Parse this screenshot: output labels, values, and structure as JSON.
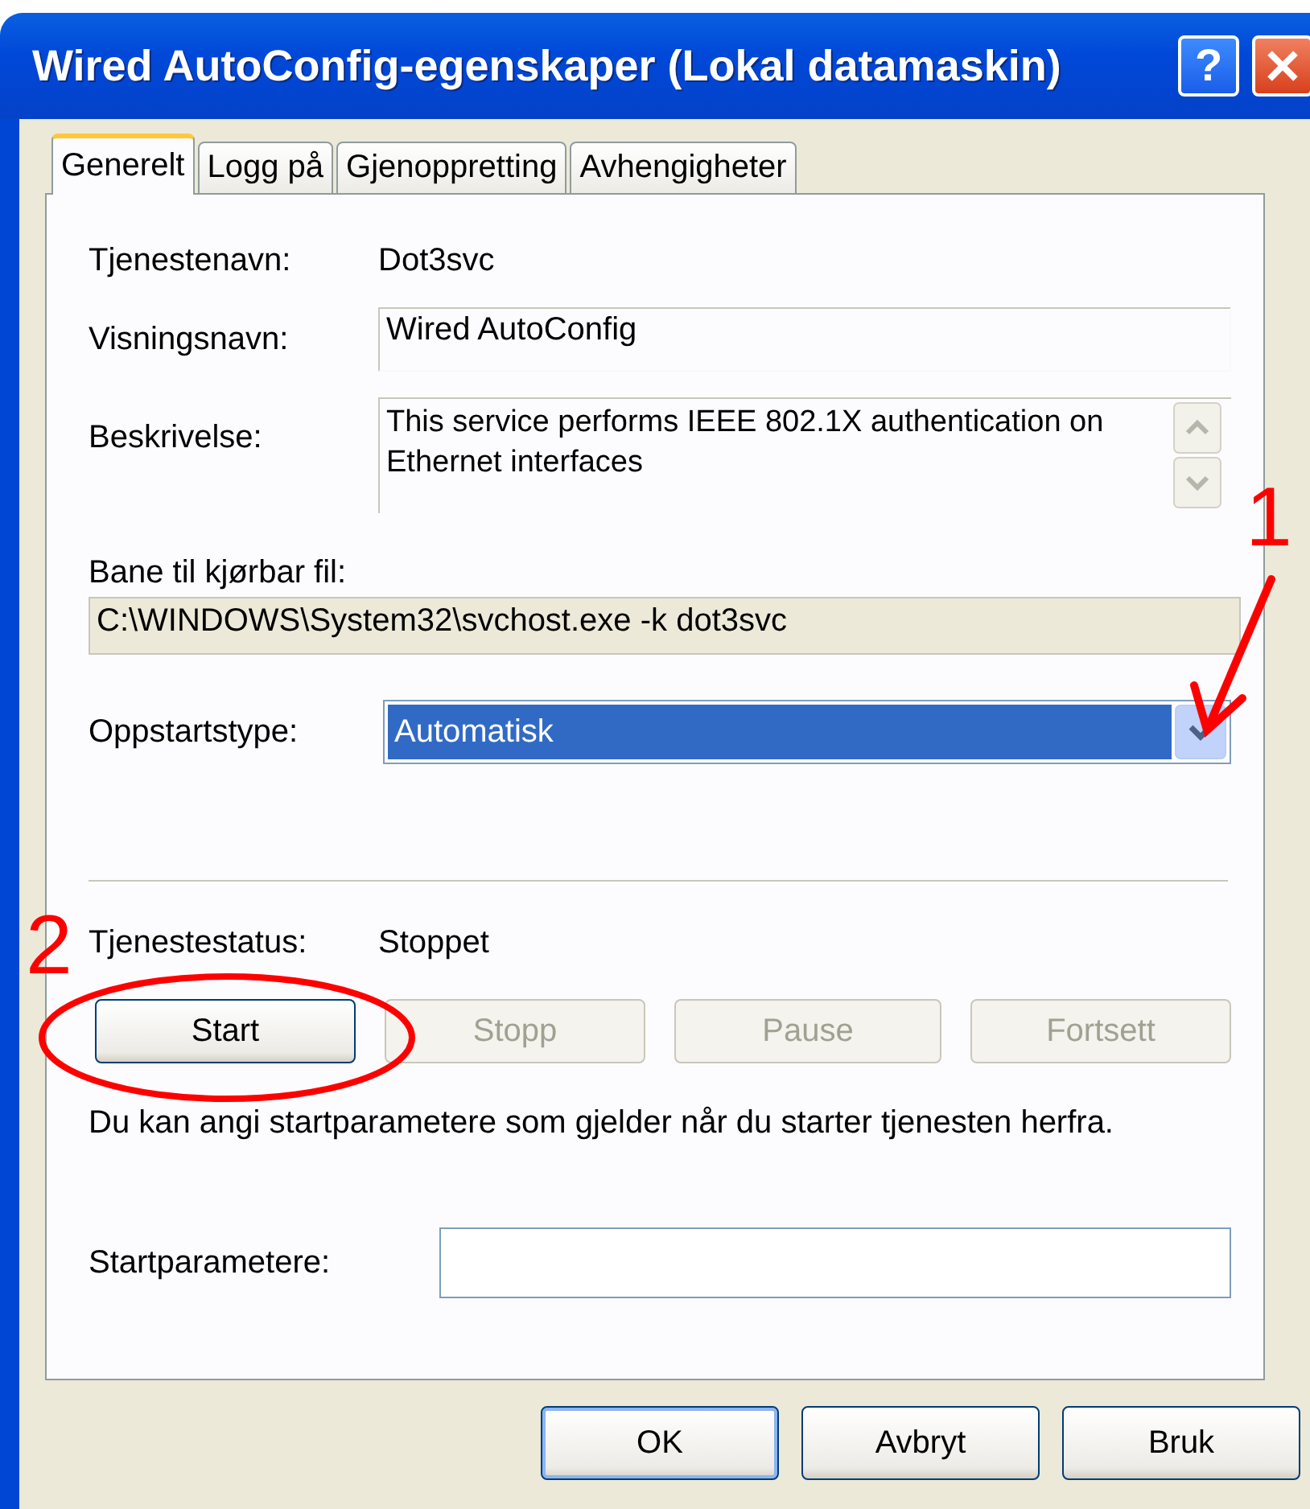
{
  "window": {
    "title": "Wired AutoConfig-egenskaper (Lokal datamaskin)",
    "help_label": "?"
  },
  "tabs": [
    {
      "label": "Generelt",
      "selected": true
    },
    {
      "label": "Logg på",
      "selected": false
    },
    {
      "label": "Gjenoppretting",
      "selected": false
    },
    {
      "label": "Avhengigheter",
      "selected": false
    }
  ],
  "service_name": {
    "label": "Tjenestenavn:",
    "value": "Dot3svc"
  },
  "display_name": {
    "label": "Visningsnavn:",
    "value": "Wired AutoConfig"
  },
  "description": {
    "label": "Beskrivelse:",
    "value": "This service performs IEEE 802.1X authentication on Ethernet interfaces"
  },
  "path": {
    "label": "Bane til kjørbar fil:",
    "value": "C:\\WINDOWS\\System32\\svchost.exe -k dot3svc"
  },
  "startup_type": {
    "label": "Oppstartstype:",
    "value": "Automatisk"
  },
  "status": {
    "label": "Tjenestestatus:",
    "value": "Stoppet"
  },
  "control_buttons": [
    {
      "label": "Start",
      "disabled": false
    },
    {
      "label": "Stopp",
      "disabled": true
    },
    {
      "label": "Pause",
      "disabled": true
    },
    {
      "label": "Fortsett",
      "disabled": true
    }
  ],
  "hint": "Du kan angi startparametere som gjelder når du starter tjenesten herfra.",
  "start_parameters": {
    "label": "Startparametere:"
  },
  "dialog_buttons": [
    {
      "label": "OK",
      "default": true
    },
    {
      "label": "Avbryt",
      "default": false
    },
    {
      "label": "Bruk",
      "default": false
    }
  ],
  "annotations": [
    {
      "kind": "number",
      "text": "1"
    },
    {
      "kind": "arrow"
    },
    {
      "kind": "number",
      "text": "2"
    },
    {
      "kind": "ellipse"
    }
  ]
}
